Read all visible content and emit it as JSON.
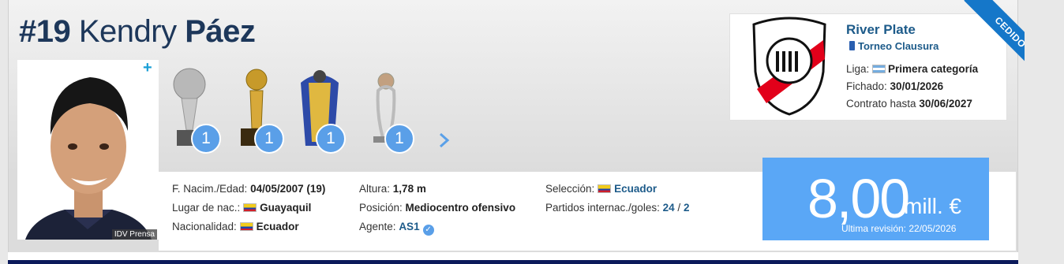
{
  "player": {
    "number": "#19",
    "first_name": "Kendry",
    "last_name": "Páez",
    "photo_credit": "IDV Prensa"
  },
  "trophies": [
    {
      "name": "copa-libertadores-trophy",
      "count": "1"
    },
    {
      "name": "recopa-trophy",
      "count": "1"
    },
    {
      "name": "league-title-trophy",
      "count": "1"
    },
    {
      "name": "supercopa-trophy",
      "count": "1"
    }
  ],
  "details": {
    "birth_label": "F. Nacim./Edad:",
    "birth_value": "04/05/2007 (19)",
    "birthplace_label": "Lugar de nac.:",
    "birthplace_value": "Guayaquil",
    "nationality_label": "Nacionalidad:",
    "nationality_value": "Ecuador",
    "height_label": "Altura:",
    "height_value": "1,78 m",
    "position_label": "Posición:",
    "position_value": "Mediocentro ofensivo",
    "agent_label": "Agente:",
    "agent_value": "AS1",
    "national_team_label": "Selección:",
    "national_team_value": "Ecuador",
    "intl_label": "Partidos internac./goles:",
    "intl_caps": "24",
    "intl_sep": "/",
    "intl_goals": "2"
  },
  "club": {
    "name": "River Plate",
    "competition": "Torneo Clausura",
    "league_label": "Liga:",
    "league_value": "Primera categoría",
    "joined_label": "Fichado:",
    "joined_value": "30/01/2026",
    "contract_label": "Contrato hasta",
    "contract_value": "30/06/2027",
    "ribbon": "CEDIDO"
  },
  "market_value": {
    "amount": "8,00",
    "unit": "mill. €",
    "last_update": "Última revisión: 22/05/2026"
  },
  "colors": {
    "accent_blue": "#5aa7f6",
    "title_navy": "#1d375a",
    "link_blue": "#1d5b8a",
    "ribbon_blue": "#1577c9"
  }
}
